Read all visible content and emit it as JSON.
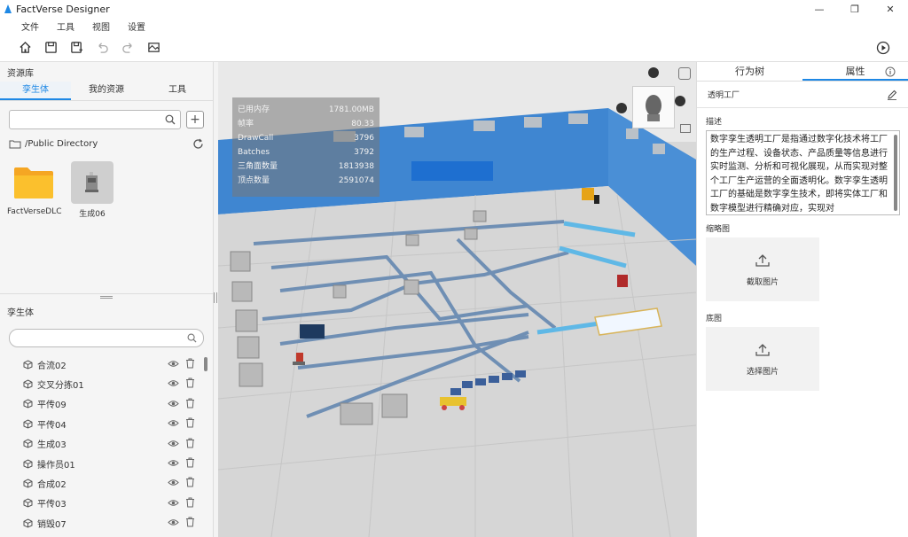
{
  "window": {
    "title": "FactVerse Designer",
    "minimize": "—",
    "maximize": "❐",
    "close": "✕"
  },
  "menu": [
    "文件",
    "工具",
    "视图",
    "设置"
  ],
  "toolbar": {
    "icons": [
      "home-icon",
      "save-icon",
      "save-as-icon",
      "undo-icon",
      "redo-icon",
      "scene-icon"
    ],
    "play": "play-icon"
  },
  "resources": {
    "title": "资源库",
    "tabs": [
      "孪生体",
      "我的资源",
      "工具"
    ],
    "active_tab": 0,
    "search_placeholder": "",
    "add": "+",
    "directory": "/Public Directory",
    "assets": [
      {
        "label": "FactVerseDLC",
        "icon": "folder-icon"
      },
      {
        "label": "生成06",
        "icon": "model-thumbnail"
      }
    ]
  },
  "twins": {
    "title": "孪生体",
    "search_placeholder": "",
    "items": [
      "合流02",
      "交叉分拣01",
      "平传09",
      "平传04",
      "生成03",
      "操作员01",
      "合成02",
      "平传03",
      "销毁07"
    ]
  },
  "stats": [
    {
      "label": "已用内存",
      "value": "1781.00MB"
    },
    {
      "label": "帧率",
      "value": "80.33"
    },
    {
      "label": "DrawCall",
      "value": "3796"
    },
    {
      "label": "Batches",
      "value": "3792"
    },
    {
      "label": "三角面数量",
      "value": "1813938"
    },
    {
      "label": "顶点数量",
      "value": "2591074"
    }
  ],
  "properties": {
    "tabs": [
      "行为树",
      "属性"
    ],
    "active_tab": 1,
    "name": "透明工厂",
    "desc_label": "描述",
    "description": "数字孪生透明工厂是指通过数字化技术将工厂的生产过程、设备状态、产品质量等信息进行实时监测、分析和可视化展现，从而实现对整个工厂生产运营的全面透明化。数字孪生透明工厂的基础是数字孪生技术，即将实体工厂和数字模型进行精确对应，实现对",
    "thumbnail_label": "缩略图",
    "thumbnail_action": "截取图片",
    "base_label": "底图",
    "base_action": "选择图片"
  },
  "colors": {
    "accent": "#1e88e5",
    "wall": "#3f86d1",
    "floor": "#d6d6d6"
  }
}
